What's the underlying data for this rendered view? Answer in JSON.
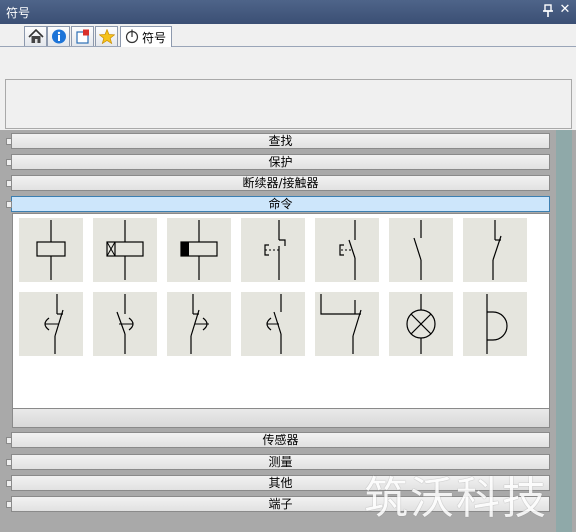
{
  "window": {
    "title": "符号"
  },
  "tabs": [
    {
      "icon": "home-icon"
    },
    {
      "icon": "info-icon"
    },
    {
      "icon": "bookmark-icon"
    },
    {
      "icon": "star-icon"
    },
    {
      "icon": "symbol-icon",
      "label": "符号",
      "active": true
    }
  ],
  "categories": {
    "search": "查找",
    "protection": "保护",
    "relay": "断续器/接触器",
    "command": "命令",
    "sensor": "传感器",
    "measure": "测量",
    "other": "其他",
    "terminal": "端子"
  },
  "selected_category": "命令",
  "symbols": [
    "coil-symbol",
    "coil-x-symbol",
    "coil-filled-symbol",
    "pushbutton-symbol",
    "pushbutton-no-symbol",
    "switch-no-symbol",
    "switch-nc-symbol",
    "contact-arrow-left-symbol",
    "contact-arrow-right-symbol",
    "contact-arrow-right-nc-symbol",
    "contact-arrow-left-alt-symbol",
    "stay-put-switch-symbol",
    "lamp-symbol",
    "buzzer-symbol"
  ],
  "watermark": "筑沃科技"
}
